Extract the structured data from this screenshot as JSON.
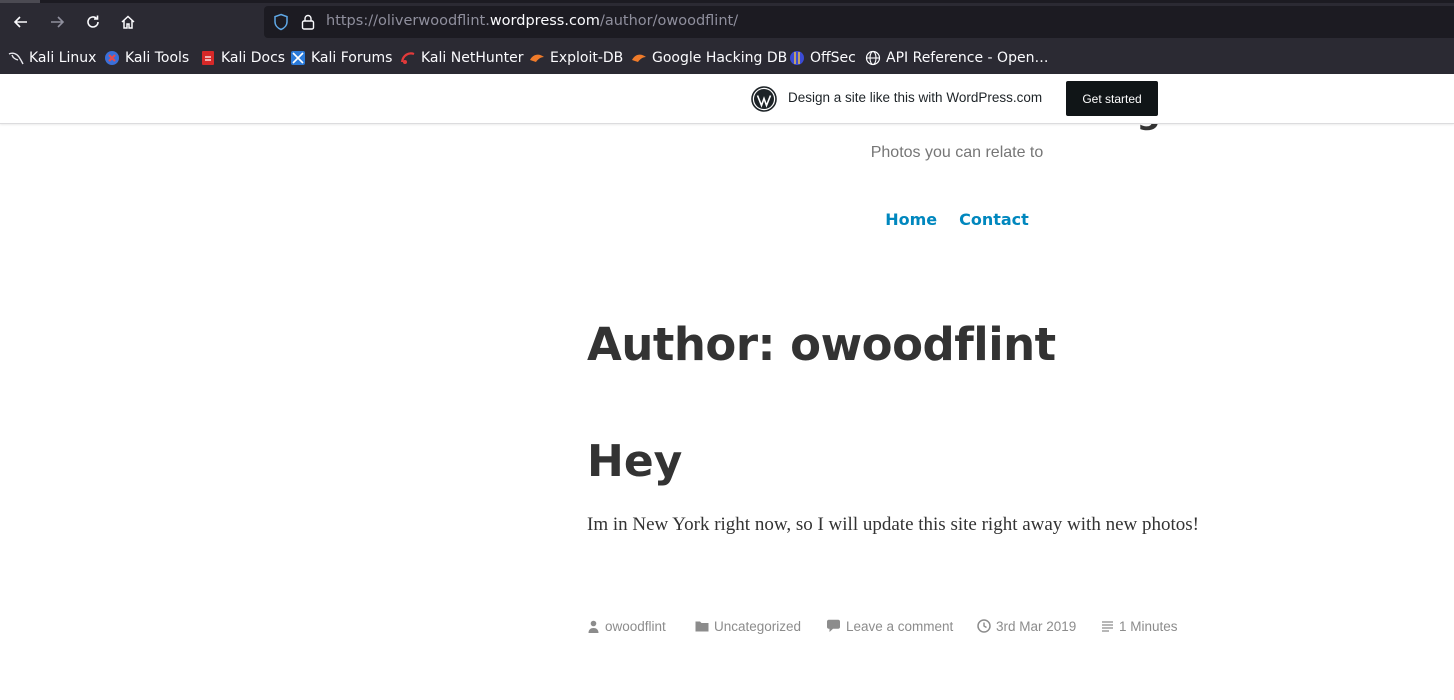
{
  "browser": {
    "url_prefix": "https://oliverwoodflint.",
    "url_domain": "wordpress.com",
    "url_path": "/author/owoodflint/",
    "bookmarks": [
      {
        "label": "Kali Linux",
        "icon": "kali-dragon-icon"
      },
      {
        "label": "Kali Tools",
        "icon": "kali-tools-icon"
      },
      {
        "label": "Kali Docs",
        "icon": "kali-docs-icon"
      },
      {
        "label": "Kali Forums",
        "icon": "kali-forums-icon"
      },
      {
        "label": "Kali NetHunter",
        "icon": "nethunter-icon"
      },
      {
        "label": "Exploit-DB",
        "icon": "exploit-db-icon"
      },
      {
        "label": "Google Hacking DB",
        "icon": "ghdb-icon"
      },
      {
        "label": "OffSec",
        "icon": "offsec-icon"
      },
      {
        "label": "API Reference - Open…",
        "icon": "globe-icon"
      }
    ]
  },
  "wp_banner": {
    "text": "Design a site like this with WordPress.com",
    "button": "Get started"
  },
  "site": {
    "title": "Oliver Woodflint Blog",
    "tagline": "Photos you can relate to",
    "menu": [
      "Home",
      "Contact"
    ]
  },
  "archive": {
    "heading": "Author: owoodflint"
  },
  "post": {
    "title": "Hey",
    "excerpt": "Im in New York right now, so I will update this site right away with new photos!",
    "meta": {
      "author": "owoodflint",
      "category": "Uncategorized",
      "comments": "Leave a comment",
      "date": "3rd Mar 2019",
      "reading_time": "1 Minutes"
    }
  },
  "colors": {
    "link": "#0087be",
    "text": "#333333",
    "meta": "#8c8c8c",
    "chrome_bg": "#2b2a33"
  }
}
